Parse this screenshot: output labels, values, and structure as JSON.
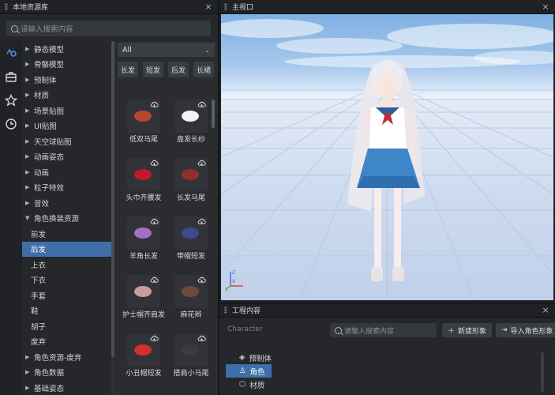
{
  "left_panel": {
    "title": "本地资源库",
    "close_glyph": "×",
    "search_placeholder": "请输入搜索内容",
    "rail_icons": [
      "link-icon",
      "toolbox-icon",
      "star-icon",
      "clock-icon"
    ],
    "tree": [
      {
        "label": "静态模型",
        "expandable": true
      },
      {
        "label": "骨骼模型",
        "expandable": true
      },
      {
        "label": "预制体",
        "expandable": true
      },
      {
        "label": "材质",
        "expandable": true
      },
      {
        "label": "场景贴图",
        "expandable": true
      },
      {
        "label": "UI贴图",
        "expandable": true
      },
      {
        "label": "天空球贴图",
        "expandable": true
      },
      {
        "label": "动画姿态",
        "expandable": true
      },
      {
        "label": "动画",
        "expandable": true
      },
      {
        "label": "粒子特效",
        "expandable": true
      },
      {
        "label": "音效",
        "expandable": true
      },
      {
        "label": "角色换装资源",
        "expandable": true,
        "expanded": true
      },
      {
        "label": "前发",
        "child": true
      },
      {
        "label": "后发",
        "child": true,
        "selected": true
      },
      {
        "label": "上衣",
        "child": true
      },
      {
        "label": "下衣",
        "child": true
      },
      {
        "label": "手套",
        "child": true
      },
      {
        "label": "鞋",
        "child": true
      },
      {
        "label": "胡子",
        "child": true
      },
      {
        "label": "废弃",
        "child": true
      },
      {
        "label": "角色资源-废弃",
        "expandable": true
      },
      {
        "label": "角色数据",
        "expandable": true
      },
      {
        "label": "基础姿态",
        "expandable": true
      }
    ],
    "filter_dropdown": "All",
    "filter_chips": [
      "长发",
      "短发",
      "后发",
      "长裙"
    ],
    "assets": [
      {
        "label": "低双马尾",
        "color": "#b5462f"
      },
      {
        "label": "盘发长纱",
        "color": "#f2f2f2"
      },
      {
        "label": "头巾齐腰发",
        "color": "#c0192a"
      },
      {
        "label": "长发马尾",
        "color": "#8e2f2a"
      },
      {
        "label": "羊角长发",
        "color": "#a66fbf"
      },
      {
        "label": "带帽短发",
        "color": "#3c4a8f"
      },
      {
        "label": "护士帽齐肩发",
        "color": "#c99aa0"
      },
      {
        "label": "麻花辫",
        "color": "#6f4a3a"
      },
      {
        "label": "小丑帽短发",
        "color": "#d32f2f"
      },
      {
        "label": "搭肩小马尾",
        "color": "#3b3b45"
      }
    ]
  },
  "viewport_panel": {
    "title": "主视口",
    "close_glyph": "×",
    "axis_labels": [
      "Z",
      "X",
      "Y"
    ]
  },
  "project_panel": {
    "title": "工程内容",
    "close_glyph": "×",
    "label": "Character",
    "search_placeholder": "请输入搜索内容",
    "new_button": "新建形象",
    "import_button": "导入角色形象",
    "items": [
      {
        "label": "预制体",
        "icon": "prefab-icon"
      },
      {
        "label": "角色",
        "icon": "character-icon",
        "selected": true
      },
      {
        "label": "材质",
        "icon": "material-icon"
      }
    ]
  },
  "colors": {
    "accent": "#3f6ea8",
    "panel_bg": "#25272b",
    "sky_top": "#7fb0e2"
  }
}
